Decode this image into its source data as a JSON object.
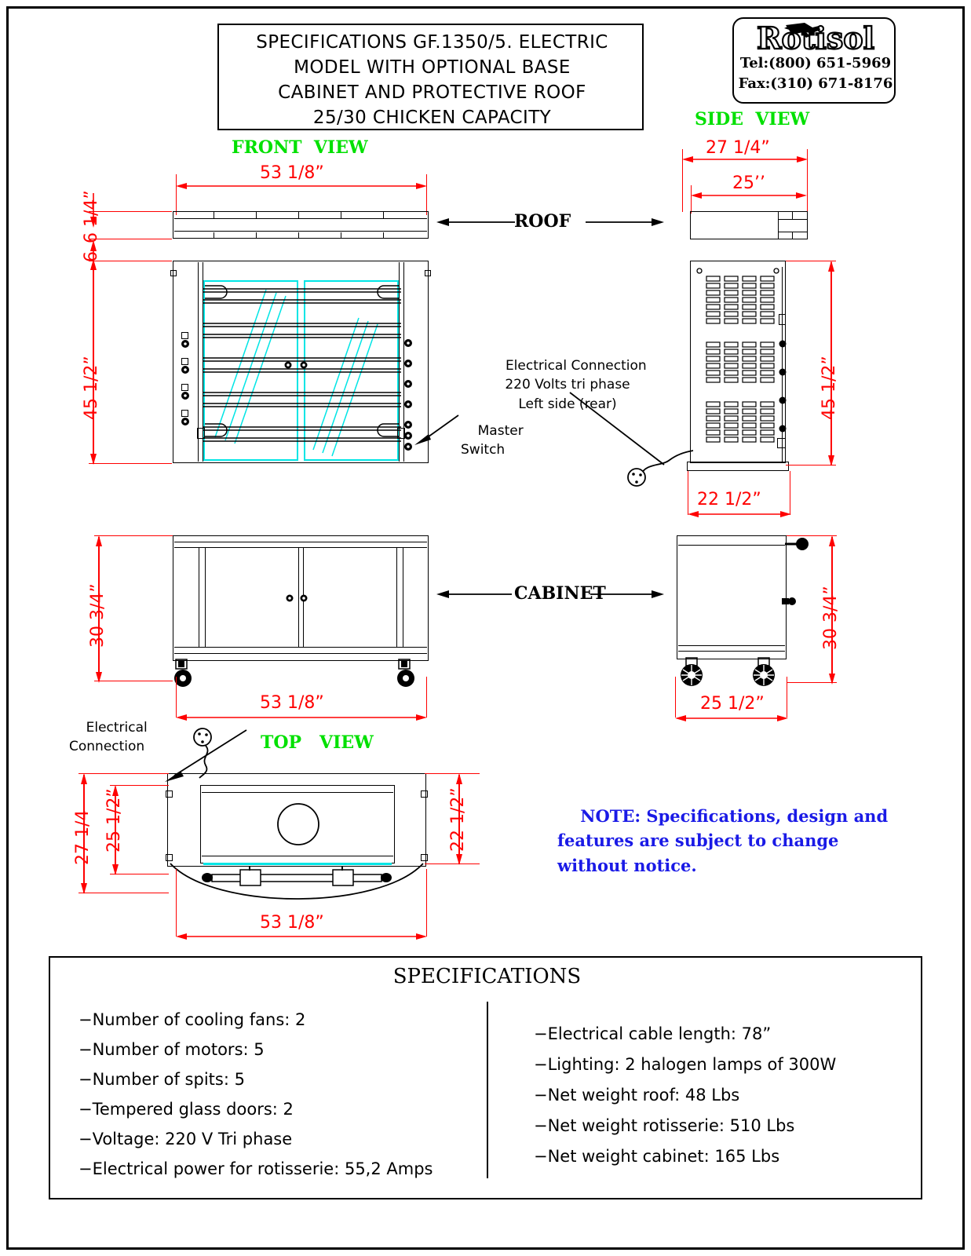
{
  "title_block": {
    "lines": [
      "SPECIFICATIONS GF.1350/5. ELECTRIC",
      "MODEL WITH OPTIONAL BASE",
      "CABINET AND PROTECTIVE ROOF",
      "25/30 CHICKEN CAPACITY"
    ]
  },
  "logo": {
    "brand": "Rotisol",
    "tel": "Tel:(800) 651-5969",
    "fax": "Fax:(310) 671-8176"
  },
  "views": {
    "front": "FRONT  VIEW",
    "side": "SIDE  VIEW",
    "top": "TOP   VIEW"
  },
  "section_labels": {
    "roof": "ROOF",
    "cabinet": "CABINET"
  },
  "dimensions": {
    "front_width": "53 1/8”",
    "roof_thickness": "6 1/4”",
    "roof_gap": "6",
    "rotisserie_height": "45 1/2”",
    "cabinet_height": "30 3/4”",
    "cabinet_width": "53 1/8”",
    "side_roof_width": "27 1/4”",
    "side_roof_inner": "25’’",
    "side_body_height": "45 1/2”",
    "side_body_depth": "22 1/2”",
    "side_cabinet_height": "30 3/4”",
    "side_cabinet_depth": "25 1/2”",
    "top_outer_depth": "27 1/4",
    "top_inner_depth": "25 1/2”",
    "top_right_depth": "22 1/2”",
    "top_width": "53 1/8”"
  },
  "annotations": {
    "electrical_connection": "Electrical Connection\n220 Volts tri phase\nLeft side (rear)",
    "master_switch": "Master\nSwitch",
    "electrical_connection_top": "Electrical\nConnection"
  },
  "note": {
    "text": "NOTE: Specifications, design and\nfeatures are subject to change\nwithout notice.",
    "color": "#1a1ae6"
  },
  "specifications": {
    "heading": "SPECIFICATIONS",
    "left_column": [
      "−Number of cooling fans: 2",
      "−Number of motors: 5",
      "−Number of spits: 5",
      "−Tempered glass doors: 2",
      "−Voltage: 220 V Tri phase",
      "−Electrical power for rotisserie: 55,2 Amps"
    ],
    "right_column": [
      "−Electrical cable length: 78”",
      "−Lighting: 2 halogen lamps of 300W",
      "−Net weight roof: 48 Lbs",
      "−Net weight rotisserie: 510 Lbs",
      "−Net weight cabinet: 165 Lbs"
    ]
  },
  "colors": {
    "dimension": "#ff0000",
    "view_label": "#00e000",
    "glass": "#00e5e5",
    "note": "#1a1ae6",
    "line": "#000000"
  }
}
